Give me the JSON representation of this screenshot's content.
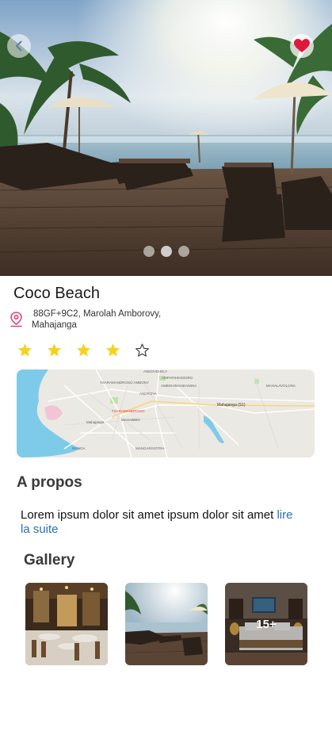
{
  "hero": {
    "back_icon": "chevron-left-icon",
    "favorite_icon": "heart-icon",
    "favorite_color": "#e0183c",
    "carousel_pages": 3,
    "carousel_active": 1
  },
  "place": {
    "name": "Coco Beach",
    "address_line1": "88GF+9C2, Marolah Amborovy,",
    "address_line2": "Mahajanga",
    "location_icon": "map-pin-icon",
    "location_icon_color": "#e0457b",
    "rating": 4,
    "rating_max": 5,
    "star_color": "#f5d21f"
  },
  "map": {
    "labels": [
      "ANDOVEHELY",
      "AMPARIHINGIDRO",
      "TSARAMANDROSO AMBONY",
      "ANDROVA",
      "Mahajanga (S1)",
      "TSARAMANDROSO",
      "Mahajanga",
      "MANGA",
      "MAHABIBO",
      "MANGARIVOTRA",
      "AMBOHIMANDAMINA",
      "MAHALAVOLONA"
    ]
  },
  "about": {
    "title": "A propos",
    "text": "Lorem ipsum dolor sit amet  ipsum dolor sit amet",
    "link": "lire la suite"
  },
  "gallery": {
    "title": "Gallery",
    "more_count": "15+"
  }
}
